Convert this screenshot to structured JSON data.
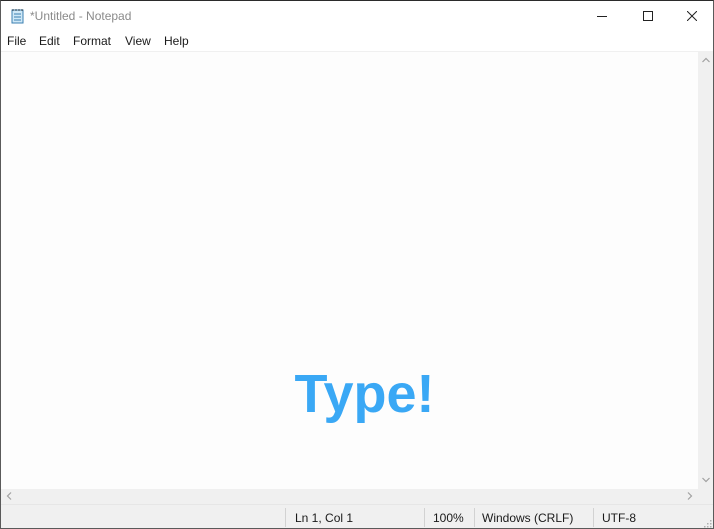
{
  "window": {
    "title": "*Untitled - Notepad",
    "app_icon": "notepad-icon",
    "controls": [
      "minimize-icon",
      "maximize-icon",
      "close-icon"
    ]
  },
  "menu": {
    "items": [
      "File",
      "Edit",
      "Format",
      "View",
      "Help"
    ]
  },
  "editor": {
    "content": "",
    "overlay_text": "Type!",
    "overlay_color": "#3aa8f5"
  },
  "statusbar": {
    "position": "Ln 1, Col 1",
    "zoom": "100%",
    "line_ending": "Windows (CRLF)",
    "encoding": "UTF-8"
  }
}
